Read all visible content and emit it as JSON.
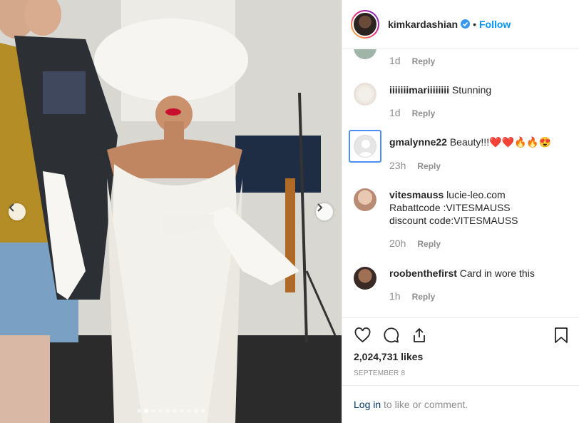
{
  "post": {
    "author": "kimkardashian",
    "follow_label": "Follow",
    "separator": "•",
    "carousel": {
      "total": 10,
      "active_index": 1
    }
  },
  "comments": [
    {
      "username": "",
      "text": "",
      "time": "1d",
      "reply_label": "Reply"
    },
    {
      "username": "iiiiiiimariiiiiiii",
      "text": "Stunning",
      "time": "1d",
      "reply_label": "Reply"
    },
    {
      "username": "gmalynne22",
      "text": "Beauty!!!❤️❤️🔥🔥😍",
      "time": "23h",
      "reply_label": "Reply"
    },
    {
      "username": "vitesmauss",
      "text": "lucie-leo.com Rabattcode :VITESMAUSS discount code:VITESMAUSS",
      "time": "20h",
      "reply_label": "Reply"
    },
    {
      "username": "roobenthefirst",
      "text": "Card in wore this",
      "time": "1h",
      "reply_label": "Reply"
    }
  ],
  "stats": {
    "likes": "2,024,731 likes",
    "date": "SEPTEMBER 8"
  },
  "footer": {
    "login_link": "Log in",
    "login_rest": " to like or comment."
  },
  "icons": [
    "chevron-left-icon",
    "chevron-right-icon",
    "verified-badge-icon",
    "heart-icon",
    "comment-icon",
    "share-icon",
    "bookmark-icon"
  ],
  "colors": {
    "link_blue": "#0095f6",
    "muted": "#8e8e8e",
    "text": "#262626",
    "focus_border": "#4f8df5"
  }
}
